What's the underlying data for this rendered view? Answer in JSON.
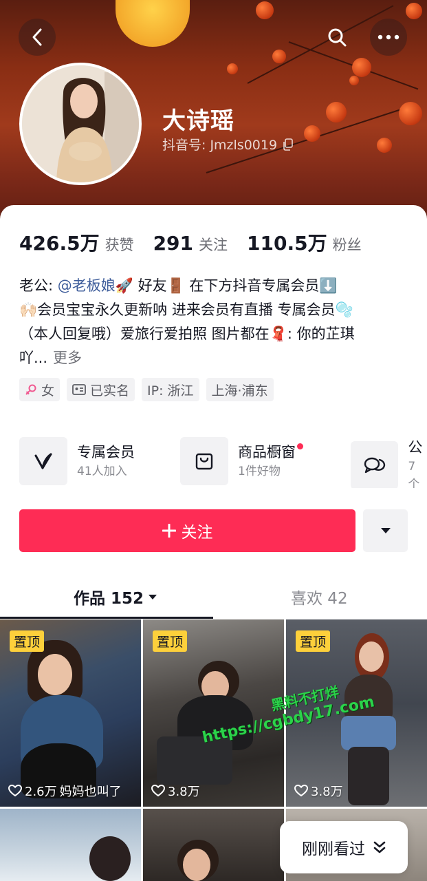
{
  "profile": {
    "name": "大诗瑶",
    "douyin_id": "抖音号: Jmzls0019"
  },
  "stats": [
    {
      "num": "426.5万",
      "label": "获赞"
    },
    {
      "num": "291",
      "label": "关注"
    },
    {
      "num": "110.5万",
      "label": "粉丝"
    }
  ],
  "bio": {
    "line1_prefix": "老公: ",
    "mention": "@老板娘",
    "line1_suffix": "🚀 好友🚪 在下方抖音专属会员⬇️",
    "line2": "🙌🏻会员宝宝永久更新呐 进来会员有直播  专属会员🫧",
    "line3": "（本人回复哦）爱旅行爱拍照 图片都在🧣: 你的芷琪",
    "line4": "吖...",
    "more": "更多"
  },
  "tags": {
    "gender": "女",
    "verified": "已实名",
    "ip": "IP: 浙江",
    "location": "上海·浦东"
  },
  "features": [
    {
      "title": "专属会员",
      "sub": "41人加入"
    },
    {
      "title": "商品橱窗",
      "sub": "1件好物"
    },
    {
      "title": "公",
      "sub": "7个"
    }
  ],
  "actions": {
    "follow": "关注"
  },
  "tabs": {
    "works": "作品 152",
    "likes": "喜欢 42"
  },
  "videos": [
    {
      "pin": "置顶",
      "likes": "2.6万",
      "caption": "妈妈也叫了"
    },
    {
      "pin": "置顶",
      "likes": "3.8万"
    },
    {
      "pin": "置顶",
      "likes": "3.8万"
    }
  ],
  "watermark": {
    "line1": "黑料不打烊",
    "line2": "https://cgbdy17.com"
  },
  "recent": {
    "label": "刚刚看过"
  },
  "colors": {
    "follow": "#fe2c55",
    "pin_badge": "#fdd03b",
    "mention": "#3d5c9a"
  }
}
